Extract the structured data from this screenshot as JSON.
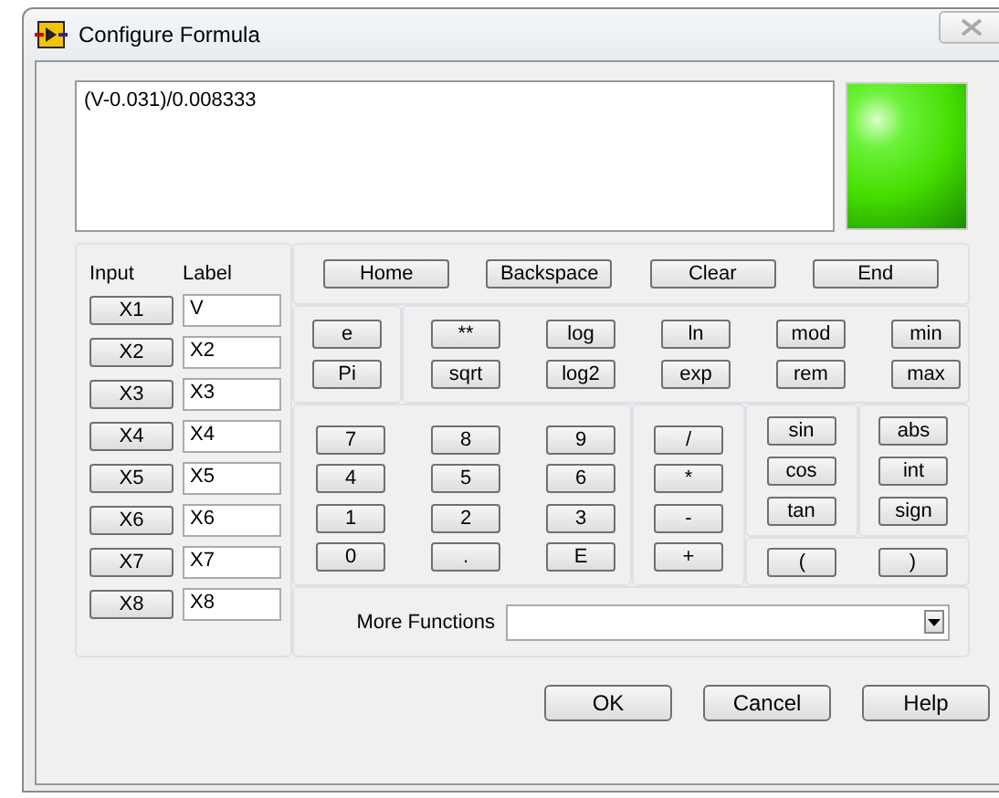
{
  "window": {
    "title": "Configure Formula"
  },
  "formula": "(V-0.031)/0.008333",
  "formula_valid": true,
  "inputs": {
    "headers": [
      "Input",
      "Label"
    ],
    "rows": [
      {
        "button": "X1",
        "label": "V"
      },
      {
        "button": "X2",
        "label": "X2"
      },
      {
        "button": "X3",
        "label": "X3"
      },
      {
        "button": "X4",
        "label": "X4"
      },
      {
        "button": "X5",
        "label": "X5"
      },
      {
        "button": "X6",
        "label": "X6"
      },
      {
        "button": "X7",
        "label": "X7"
      },
      {
        "button": "X8",
        "label": "X8"
      }
    ]
  },
  "nav_buttons": [
    "Home",
    "Backspace",
    "Clear",
    "End"
  ],
  "constants": [
    "e",
    "Pi"
  ],
  "functions": [
    [
      "**",
      "log",
      "ln",
      "mod",
      "min"
    ],
    [
      "sqrt",
      "log2",
      "exp",
      "rem",
      "max"
    ]
  ],
  "digits": [
    [
      "7",
      "8",
      "9"
    ],
    [
      "4",
      "5",
      "6"
    ],
    [
      "1",
      "2",
      "3"
    ],
    [
      "0",
      ".",
      "E"
    ]
  ],
  "operators": [
    "/",
    "*",
    "-",
    "+"
  ],
  "trig": [
    [
      "sin",
      "abs"
    ],
    [
      "cos",
      "int"
    ],
    [
      "tan",
      "sign"
    ]
  ],
  "parens": [
    "(",
    ")"
  ],
  "more_functions": {
    "label": "More Functions"
  },
  "buttons": [
    "OK",
    "Cancel",
    "Help"
  ]
}
